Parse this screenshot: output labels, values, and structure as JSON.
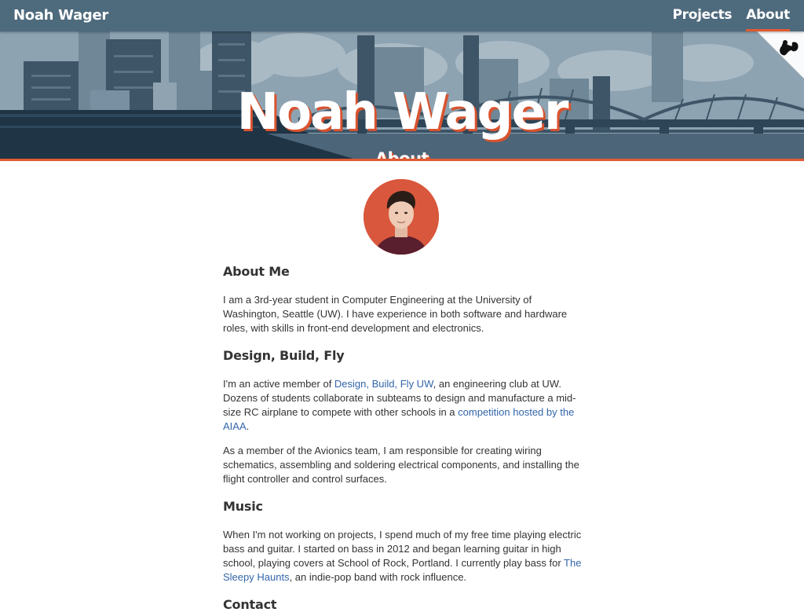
{
  "nav": {
    "brand": "Noah Wager",
    "links": [
      "Projects",
      "About"
    ],
    "active": "About"
  },
  "hero": {
    "title": "Noah Wager",
    "subtitle": "About"
  },
  "colors": {
    "accent": "#e05a33",
    "nav_bg": "#4e6a7d",
    "link": "#3366aa"
  },
  "icons": {
    "corner": "squirrel-icon"
  },
  "sections": {
    "about": {
      "heading": "About Me",
      "text": "I am a 3rd-year student in Computer Engineering at the University of Washington, Seattle (UW). I have experience in both software and hardware roles, with skills in front-end development and electronics."
    },
    "dbf": {
      "heading": "Design, Build, Fly",
      "p1_a": "I'm an active member of ",
      "p1_link1": "Design, Build, Fly UW",
      "p1_b": ", an engineering club at UW. Dozens of students collaborate in subteams to design and manufacture a mid-size RC airplane to compete with other schools in a ",
      "p1_link2": "competition hosted by the AIAA",
      "p1_c": ".",
      "p2": "As a member of the Avionics team, I am responsible for creating wiring schematics, assembling and soldering electrical components, and installing the flight controller and control surfaces."
    },
    "music": {
      "heading": "Music",
      "p_a": "When I'm not working on projects, I spend much of my free time playing electric bass and guitar. I started on bass in 2012 and began learning guitar in high school, playing covers at School of Rock, Portland. I currently play bass for ",
      "p_link": "The Sleepy Haunts",
      "p_b": ", an indie-pop band with rock influence."
    },
    "contact": {
      "heading": "Contact"
    }
  }
}
